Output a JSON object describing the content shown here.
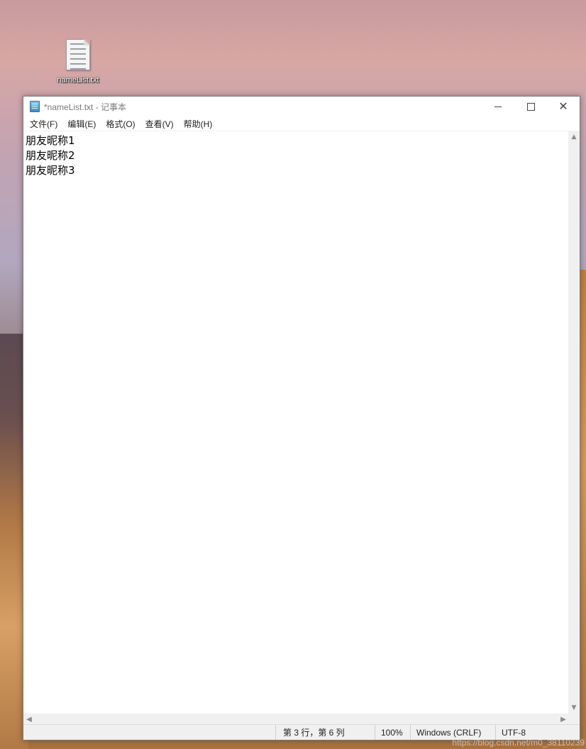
{
  "desktop": {
    "icon_label": "nameList.txt"
  },
  "window": {
    "title": "*nameList.txt - 记事本",
    "controls": {
      "minimize": "minimize",
      "maximize": "maximize",
      "close": "close"
    }
  },
  "menu": {
    "items": [
      "文件(F)",
      "编辑(E)",
      "格式(O)",
      "查看(V)",
      "帮助(H)"
    ]
  },
  "editor": {
    "lines": [
      "朋友昵称1",
      "朋友昵称2",
      "朋友昵称3"
    ]
  },
  "status": {
    "position": "第 3 行，第 6 列",
    "zoom": "100%",
    "line_ending": "Windows (CRLF)",
    "encoding": "UTF-8"
  },
  "watermark": "https://blog.csdn.net/m0_38110239",
  "colors": {
    "window_bg": "#ffffff",
    "statusbar_bg": "#f0f0f0",
    "title_text": "#7a7a7a"
  }
}
